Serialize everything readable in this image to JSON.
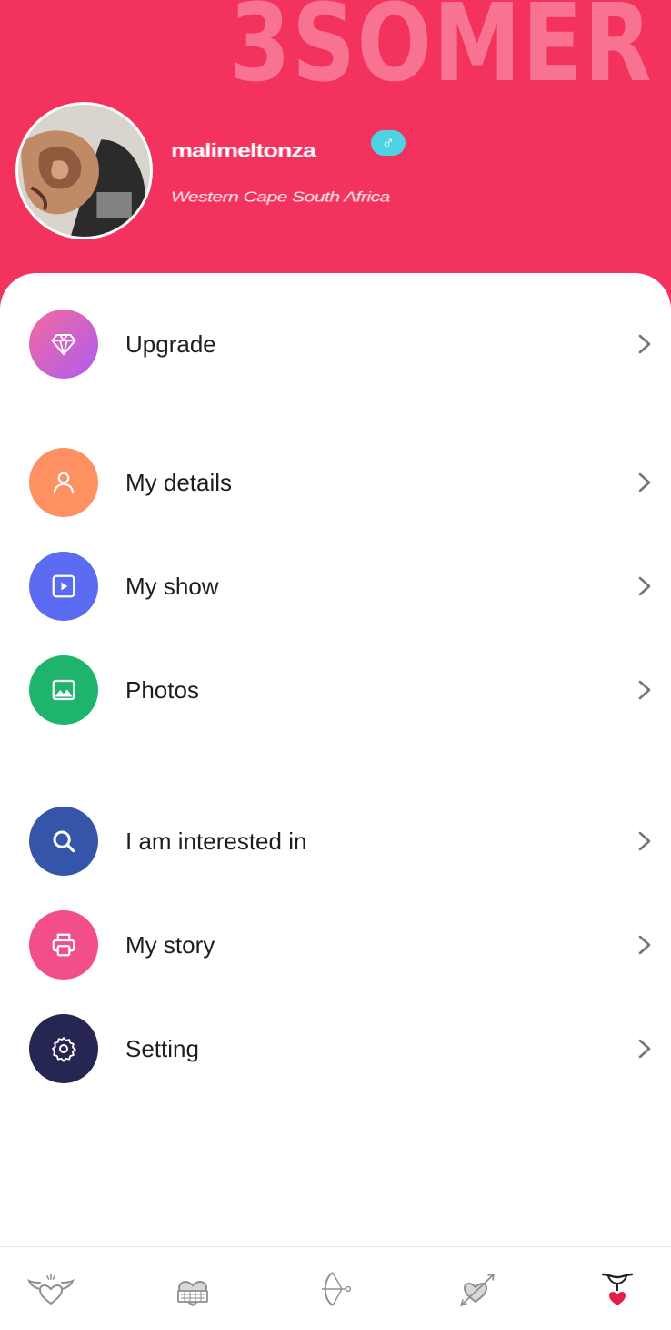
{
  "header": {
    "brand": "3SOMER",
    "username": "malimeltonza",
    "gender_symbol": "♂",
    "location": "Western Cape South Africa"
  },
  "colors": {
    "header_bg": "#f3325e",
    "upgrade_gradient": [
      "#f25b8f",
      "#a95cf0"
    ],
    "details": "#ff9062",
    "show": "#5c6cf2",
    "photos": "#1fb46b",
    "interested": "#3556a8",
    "story": "#f24f8a",
    "setting": "#262652"
  },
  "menu": {
    "upgrade": {
      "label": "Upgrade",
      "icon": "diamond-icon"
    },
    "my_details": {
      "label": "My details",
      "icon": "person-icon"
    },
    "my_show": {
      "label": "My show",
      "icon": "play-icon"
    },
    "photos": {
      "label": "Photos",
      "icon": "image-icon"
    },
    "interested_in": {
      "label": "I am interested in",
      "icon": "search-icon"
    },
    "my_story": {
      "label": "My story",
      "icon": "printer-icon"
    },
    "setting": {
      "label": "Setting",
      "icon": "gear-icon"
    }
  },
  "bottom_nav": {
    "tabs": [
      {
        "icon": "winged-heart-icon",
        "active": false
      },
      {
        "icon": "heart-card-icon",
        "active": false
      },
      {
        "icon": "bow-arrow-icon",
        "active": false
      },
      {
        "icon": "heart-arrow-icon",
        "active": false
      },
      {
        "icon": "heart-pin-icon",
        "active": true
      }
    ]
  }
}
